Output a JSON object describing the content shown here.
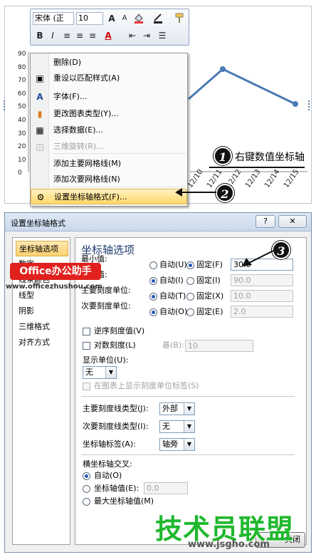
{
  "toolbar": {
    "font_name": "宋体 (正",
    "font_size": "10",
    "icons": [
      "grow-font-icon",
      "shrink-font-icon",
      "fill-color-icon",
      "line-color-icon",
      "format-painter-icon",
      "bold-icon",
      "italic-icon",
      "align-left-icon",
      "align-center-icon",
      "align-right-icon",
      "font-color-icon",
      "decrease-indent-icon",
      "increase-indent-icon",
      "list-icon"
    ],
    "bold_label": "B",
    "italic_label": "I",
    "grow_label": "A",
    "shrink_label": "A"
  },
  "chart": {
    "y_ticks": [
      "90",
      "80",
      "70",
      "60",
      "50",
      "40",
      "30",
      "20",
      "10",
      "0"
    ],
    "x_labels": [
      "12/10",
      "12/11",
      "12/12",
      "12/13",
      "12/14",
      "12/15"
    ],
    "line_color": "#4a7ab5"
  },
  "context_menu": {
    "items": [
      {
        "label": "删除(D)",
        "icon": "delete-icon",
        "disabled": false
      },
      {
        "label": "重设以匹配样式(A)",
        "icon": "reset-style-icon",
        "disabled": false
      },
      {
        "label": "字体(F)...",
        "icon": "font-icon",
        "disabled": false
      },
      {
        "label": "更改图表类型(Y)...",
        "icon": "chart-type-icon",
        "disabled": false
      },
      {
        "label": "选择数据(E)...",
        "icon": "select-data-icon",
        "disabled": false
      },
      {
        "label": "三维旋转(R)...",
        "icon": "3d-rotation-icon",
        "disabled": true
      },
      {
        "label": "添加主要网格线(M)",
        "icon": "",
        "disabled": false
      },
      {
        "label": "添加次要网格线(N)",
        "icon": "",
        "disabled": false
      },
      {
        "label": "设置坐标轴格式(F)...",
        "icon": "format-axis-icon",
        "disabled": false,
        "highlighted": true
      }
    ]
  },
  "callouts": {
    "one": "1",
    "one_text": "右键数值坐标轴",
    "two": "2",
    "three": "3"
  },
  "dialog": {
    "title": "设置坐标轴格式",
    "help_label": "?",
    "close_label": "✕",
    "nav": [
      "坐标轴选项",
      "数字",
      "线条颜色",
      "线型",
      "阴影",
      "三维格式",
      "对齐方式"
    ],
    "section_title": "坐标轴选项",
    "rows": [
      {
        "label": "最小值:",
        "auto": "自动(U)",
        "fixed": "固定(F)",
        "value": "30.0",
        "mode": "fixed"
      },
      {
        "label": "最大值:",
        "auto": "自动(I)",
        "fixed": "固定(I)",
        "value": "90.0",
        "mode": "auto"
      },
      {
        "label": "主要刻度单位:",
        "auto": "自动(T)",
        "fixed": "固定(X)",
        "value": "10.0",
        "mode": "auto"
      },
      {
        "label": "次要刻度单位:",
        "auto": "自动(O)",
        "fixed": "固定(E)",
        "value": "2.0",
        "mode": "auto"
      }
    ],
    "reverse_order": "逆序刻度值(V)",
    "log_scale": "对数刻度(L)",
    "log_base_label": "基(B):",
    "log_base_value": "10",
    "display_units_label": "显示单位(U):",
    "display_units_value": "无",
    "show_units_label": "在图表上显示刻度单位标签(S)",
    "major_tick_label": "主要刻度线类型(J):",
    "major_tick_value": "外部",
    "minor_tick_label": "次要刻度线类型(I):",
    "minor_tick_value": "无",
    "axis_labels_label": "坐标轴标签(A):",
    "axis_labels_value": "轴旁",
    "cross_title": "横坐标轴交叉:",
    "cross_auto": "自动(O)",
    "cross_value_label": "坐标轴值(E):",
    "cross_value": "0.0",
    "cross_max": "最大坐标轴值(M)",
    "close_button": "关闭"
  },
  "watermarks": {
    "office": "Office办公助手",
    "office_url": "www.officezhushou.com",
    "jsgho_cn": "技术员联盟",
    "jsgho_url": "www.jsgho.com"
  }
}
